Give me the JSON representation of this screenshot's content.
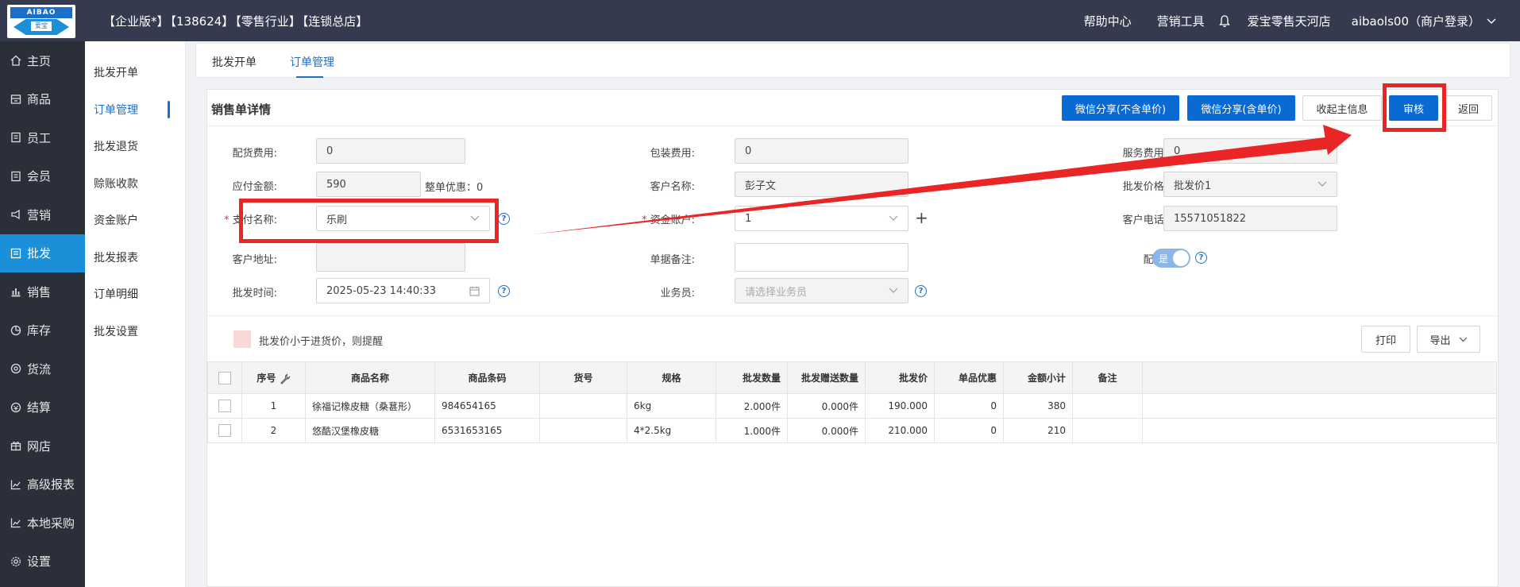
{
  "header": {
    "edition": [
      "【企业版*】",
      "【138624】",
      "【零售行业】",
      "【连锁总店】"
    ],
    "logo_text": "AIBAO",
    "logo_sub": "爱宝",
    "help_center": "帮助中心",
    "marketing_tools": "营销工具",
    "store_name": "爱宝零售天河店",
    "user": "aibaols00（商户登录）"
  },
  "sidebar": {
    "items": [
      {
        "label": "主页",
        "icon": "home-icon"
      },
      {
        "label": "商品",
        "icon": "box-icon"
      },
      {
        "label": "员工",
        "icon": "doc-icon"
      },
      {
        "label": "会员",
        "icon": "doc-icon"
      },
      {
        "label": "营销",
        "icon": "megaphone-icon"
      },
      {
        "label": "批发",
        "icon": "wholesale-icon"
      },
      {
        "label": "销售",
        "icon": "bar-chart-icon"
      },
      {
        "label": "库存",
        "icon": "pie-icon"
      },
      {
        "label": "货流",
        "icon": "flow-icon"
      },
      {
        "label": "结算",
        "icon": "settle-icon"
      },
      {
        "label": "网店",
        "icon": "gift-icon"
      },
      {
        "label": "高级报表",
        "icon": "line-chart-icon"
      },
      {
        "label": "本地采购",
        "icon": "line-chart-icon"
      },
      {
        "label": "设置",
        "icon": "gear-icon"
      }
    ],
    "active": "批发"
  },
  "submenu": {
    "items": [
      "批发开单",
      "订单管理",
      "批发退货",
      "赊账收款",
      "资金账户",
      "批发报表",
      "订单明细",
      "批发设置"
    ],
    "active": "订单管理"
  },
  "tabs": [
    "批发开单",
    "订单管理"
  ],
  "panel": {
    "title": "销售单详情",
    "buttons": {
      "share_no_price": "微信分享(不含单价)",
      "share_price": "微信分享(含单价)",
      "receiver_info": "收起主信息",
      "approve": "审核",
      "back": "返回"
    },
    "fields": {
      "delivery_fee_label": "配货费用:",
      "delivery_fee": "0",
      "packing_fee_label": "包装费用:",
      "packing_fee": "0",
      "service_fee_label": "服务费用:",
      "service_fee": "0",
      "payable_label": "应付金额:",
      "payable": "590",
      "discount_label": "整单优惠：0",
      "customer_name_label": "客户名称:",
      "customer_name": "彭子文",
      "price_level_label": "批发价格:",
      "price_level": "批发价1",
      "payment_name_label": "支付名称:",
      "payment_name": "乐刷",
      "fund_account_label": "资金账户:",
      "fund_account": "1",
      "phone_label": "客户电话:",
      "phone": "15571051822",
      "address_label": "客户地址:",
      "address": "",
      "remark_label": "单据备注:",
      "remark": "",
      "delivery_label": "配货:",
      "delivery_toggle": "是",
      "time_label": "批发时间:",
      "time": "2025-05-23 14:40:33",
      "salesman_label": "业务员:",
      "salesman_placeholder": "请选择业务员"
    },
    "warning": "批发价小于进货价，则提醒",
    "print": "打印",
    "export": "导出"
  },
  "table": {
    "headers": [
      "序号",
      "商品名称",
      "商品条码",
      "货号",
      "规格",
      "批发数量",
      "批发赠送数量",
      "批发价",
      "单品优惠",
      "金额小计",
      "备注"
    ],
    "rows": [
      [
        "1",
        "徐福记橡皮糖（桑葚形）",
        "984654165",
        "",
        "6kg",
        "2.000件",
        "0.000件",
        "190.000",
        "0",
        "380",
        ""
      ],
      [
        "2",
        "悠酷汉堡橡皮糖",
        "6531653165",
        "",
        "4*2.5kg",
        "1.000件",
        "0.000件",
        "210.000",
        "0",
        "210",
        ""
      ]
    ]
  },
  "colors": {
    "header_bg": "#353a4f",
    "sidebar_bg": "#2b2f3a",
    "active_blue": "#1b8fd8",
    "primary_button": "#0a6ad4",
    "annotation_red": "#ea2525"
  }
}
